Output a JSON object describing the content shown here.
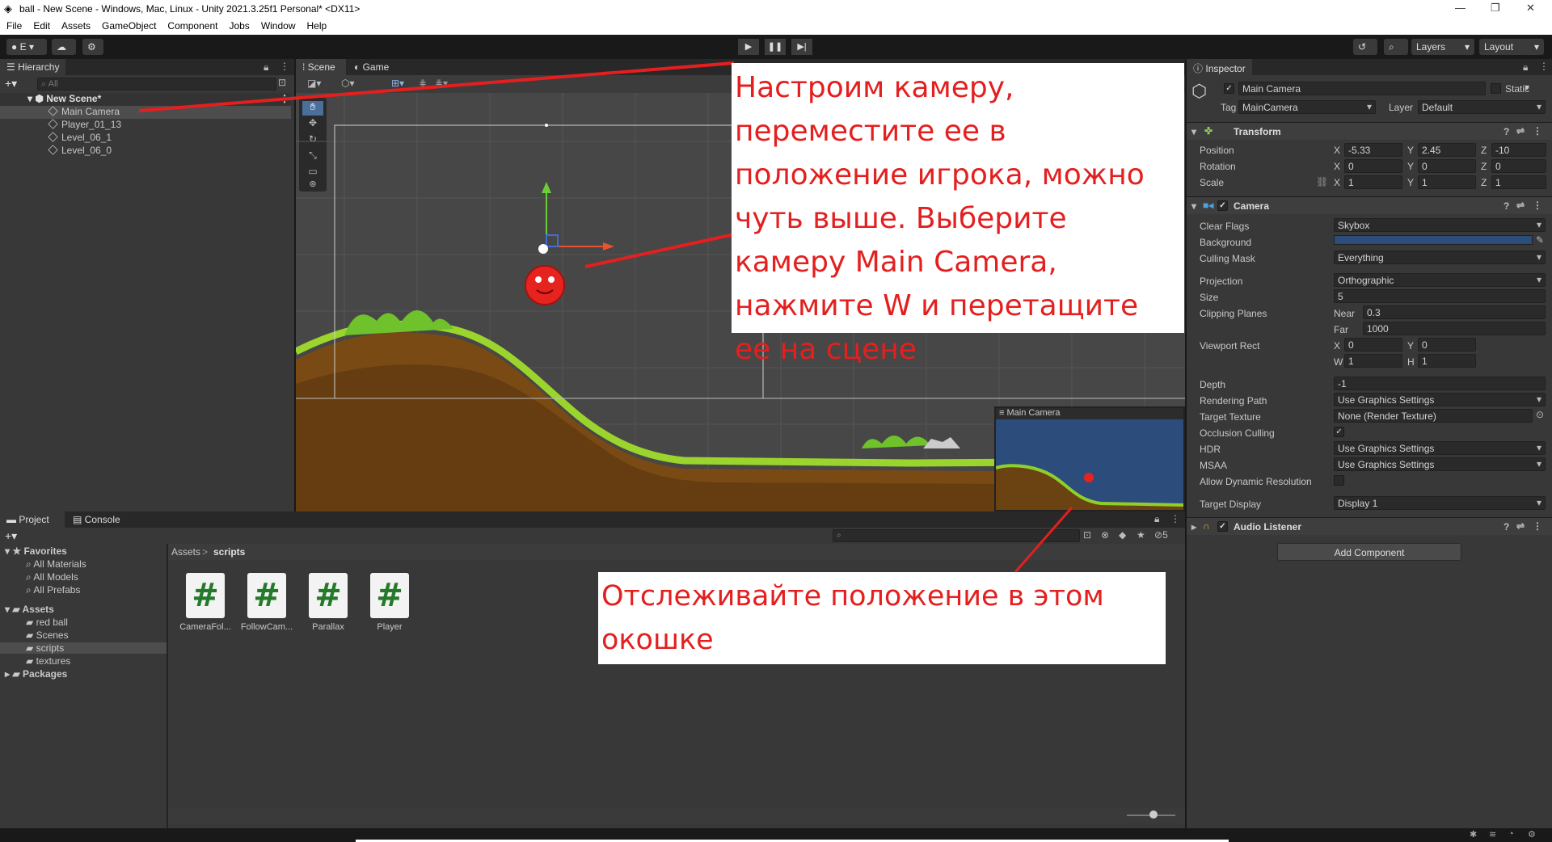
{
  "window": {
    "title": "ball - New Scene - Windows, Mac, Linux - Unity 2021.3.25f1 Personal* <DX11>"
  },
  "menu": [
    "File",
    "Edit",
    "Assets",
    "GameObject",
    "Component",
    "Jobs",
    "Window",
    "Help"
  ],
  "toolbar": {
    "account": "E",
    "layers": "Layers",
    "layout": "Layout"
  },
  "hierarchy": {
    "tab": "Hierarchy",
    "search_placeholder": "All",
    "scene": "New Scene*",
    "items": [
      "Main Camera",
      "Player_01_13",
      "Level_06_1",
      "Level_06_0"
    ]
  },
  "scene_view": {
    "tabs": [
      "Scene",
      "Game"
    ],
    "camera_preview_title": "Main Camera"
  },
  "annotations": {
    "top": "Настроим камеру, переместите ее в положение игрока, можно чуть выше. Выберите камеру Main Camera, нажмите W и перетащите ее на сцене",
    "bottom": "Отслеживайте положение в этом окошке"
  },
  "project": {
    "tabs": [
      "Project",
      "Console"
    ],
    "favorites_label": "Favorites",
    "favorites": [
      "All Materials",
      "All Models",
      "All Prefabs"
    ],
    "assets_label": "Assets",
    "assets": [
      "red ball",
      "Scenes",
      "scripts",
      "textures"
    ],
    "packages_label": "Packages",
    "breadcrumb": [
      "Assets",
      "scripts"
    ],
    "hidden_count": "5",
    "files": [
      "CameraFol...",
      "FollowCam...",
      "Parallax",
      "Player"
    ]
  },
  "inspector": {
    "tab": "Inspector",
    "object_name": "Main Camera",
    "static_label": "Static",
    "tag_label": "Tag",
    "tag": "MainCamera",
    "layer_label": "Layer",
    "layer": "Default",
    "transform": {
      "title": "Transform",
      "position_label": "Position",
      "position": {
        "x": "-5.33",
        "y": "2.45",
        "z": "-10"
      },
      "rotation_label": "Rotation",
      "rotation": {
        "x": "0",
        "y": "0",
        "z": "0"
      },
      "scale_label": "Scale",
      "scale": {
        "x": "1",
        "y": "1",
        "z": "1"
      }
    },
    "camera": {
      "title": "Camera",
      "clear_flags_label": "Clear Flags",
      "clear_flags": "Skybox",
      "background_label": "Background",
      "background_color": "#2c4c7c",
      "culling_mask_label": "Culling Mask",
      "culling_mask": "Everything",
      "projection_label": "Projection",
      "projection": "Orthographic",
      "size_label": "Size",
      "size": "5",
      "clipping_label": "Clipping Planes",
      "near_label": "Near",
      "near": "0.3",
      "far_label": "Far",
      "far": "1000",
      "viewport_label": "Viewport Rect",
      "viewport": {
        "x": "0",
        "y": "0",
        "w": "1",
        "h": "1"
      },
      "depth_label": "Depth",
      "depth": "-1",
      "rendering_path_label": "Rendering Path",
      "rendering_path": "Use Graphics Settings",
      "target_texture_label": "Target Texture",
      "target_texture": "None (Render Texture)",
      "occlusion_label": "Occlusion Culling",
      "hdr_label": "HDR",
      "hdr": "Use Graphics Settings",
      "msaa_label": "MSAA",
      "msaa": "Use Graphics Settings",
      "dynres_label": "Allow Dynamic Resolution",
      "target_display_label": "Target Display",
      "target_display": "Display 1"
    },
    "audio_listener": "Audio Listener",
    "add_component": "Add Component"
  },
  "colors": {
    "accent_red": "#e41f1f",
    "selection": "#2c5d87",
    "grass": "#7bc62d"
  }
}
